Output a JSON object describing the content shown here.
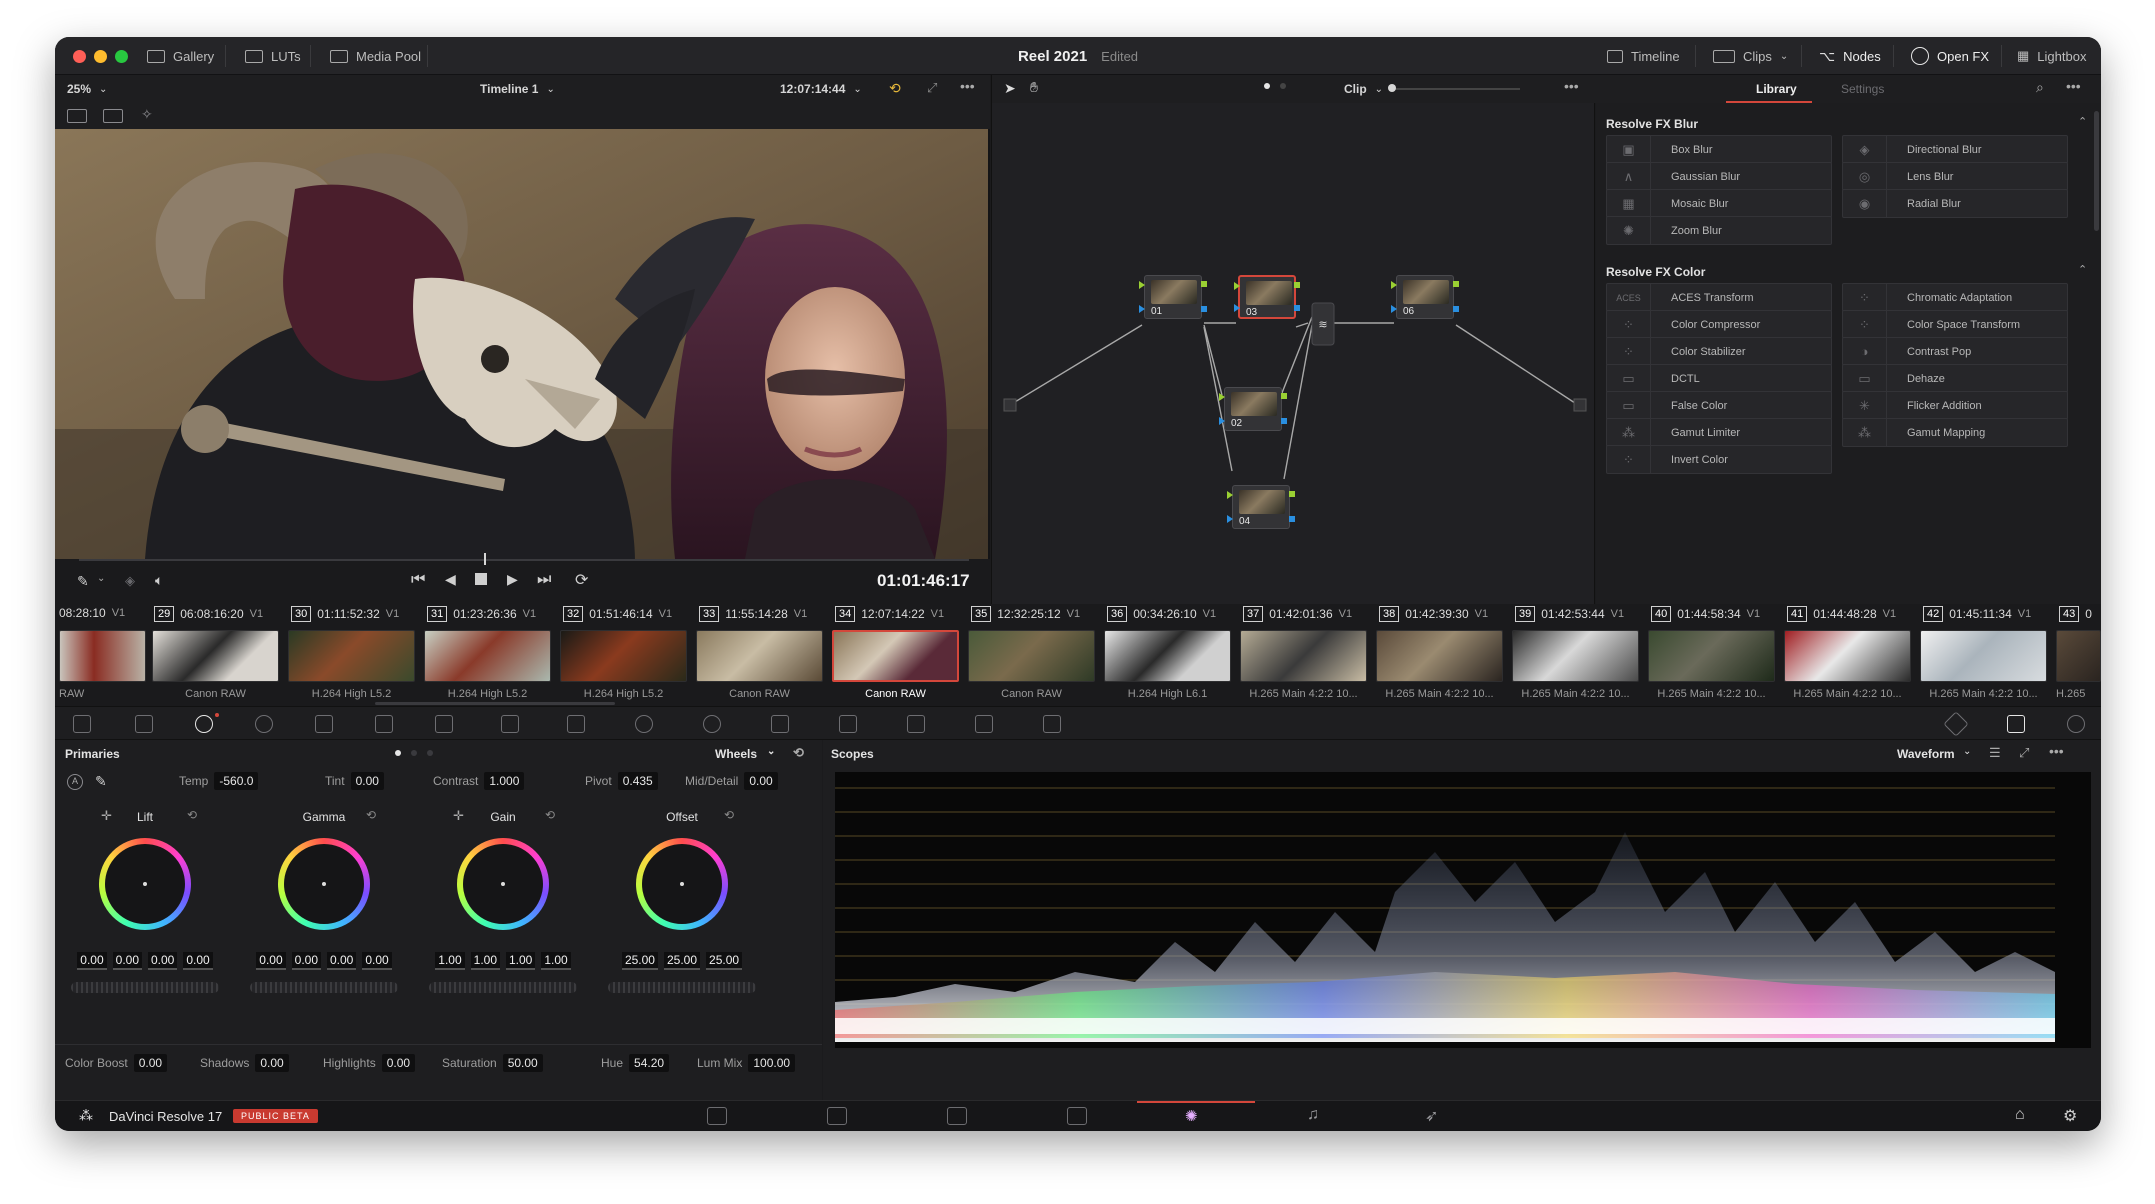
{
  "titlebar": {
    "left_tabs": [
      "Gallery",
      "LUTs",
      "Media Pool"
    ],
    "project": "Reel 2021",
    "status": "Edited",
    "right_tabs": [
      "Timeline",
      "Clips",
      "Nodes",
      "Open FX",
      "Lightbox"
    ]
  },
  "viewer": {
    "zoom": "25%",
    "timeline_name": "Timeline 1",
    "timecode_top": "12:07:14:44",
    "timecode": "01:01:46:17"
  },
  "node_editor": {
    "mode": "Clip",
    "nodes": [
      "01",
      "02",
      "03",
      "04",
      "06"
    ]
  },
  "library": {
    "tabs": [
      "Library",
      "Settings"
    ],
    "sections": [
      {
        "title": "Resolve FX Blur",
        "items": [
          "Box Blur",
          "Directional Blur",
          "Gaussian Blur",
          "Lens Blur",
          "Mosaic Blur",
          "Radial Blur",
          "Zoom Blur"
        ]
      },
      {
        "title": "Resolve FX Color",
        "items": [
          "ACES Transform",
          "Chromatic Adaptation",
          "Color Compressor",
          "Color Space Transform",
          "Color Stabilizer",
          "Contrast Pop",
          "DCTL",
          "Dehaze",
          "False Color",
          "Flicker Addition",
          "Gamut Limiter",
          "Gamut Mapping",
          "Invert Color"
        ]
      }
    ]
  },
  "clips": [
    {
      "num": "",
      "tc": "08:28:10",
      "track": "V1",
      "codec": "RAW"
    },
    {
      "num": "29",
      "tc": "06:08:16:20",
      "track": "V1",
      "codec": "Canon RAW"
    },
    {
      "num": "30",
      "tc": "01:11:52:32",
      "track": "V1",
      "codec": "H.264 High L5.2"
    },
    {
      "num": "31",
      "tc": "01:23:26:36",
      "track": "V1",
      "codec": "H.264 High L5.2"
    },
    {
      "num": "32",
      "tc": "01:51:46:14",
      "track": "V1",
      "codec": "H.264 High L5.2"
    },
    {
      "num": "33",
      "tc": "11:55:14:28",
      "track": "V1",
      "codec": "Canon RAW"
    },
    {
      "num": "34",
      "tc": "12:07:14:22",
      "track": "V1",
      "codec": "Canon RAW"
    },
    {
      "num": "35",
      "tc": "12:32:25:12",
      "track": "V1",
      "codec": "Canon RAW"
    },
    {
      "num": "36",
      "tc": "00:34:26:10",
      "track": "V1",
      "codec": "H.264 High L6.1"
    },
    {
      "num": "37",
      "tc": "01:42:01:36",
      "track": "V1",
      "codec": "H.265 Main 4:2:2 10..."
    },
    {
      "num": "38",
      "tc": "01:42:39:30",
      "track": "V1",
      "codec": "H.265 Main 4:2:2 10..."
    },
    {
      "num": "39",
      "tc": "01:42:53:44",
      "track": "V1",
      "codec": "H.265 Main 4:2:2 10..."
    },
    {
      "num": "40",
      "tc": "01:44:58:34",
      "track": "V1",
      "codec": "H.265 Main 4:2:2 10..."
    },
    {
      "num": "41",
      "tc": "01:44:48:28",
      "track": "V1",
      "codec": "H.265 Main 4:2:2 10..."
    },
    {
      "num": "42",
      "tc": "01:45:11:34",
      "track": "V1",
      "codec": "H.265 Main 4:2:2 10..."
    },
    {
      "num": "43",
      "tc": "0",
      "track": "",
      "codec": "H.265"
    }
  ],
  "primaries": {
    "title": "Primaries",
    "mode": "Wheels",
    "top_params": [
      {
        "label": "Temp",
        "value": "-560.0"
      },
      {
        "label": "Tint",
        "value": "0.00"
      },
      {
        "label": "Contrast",
        "value": "1.000"
      },
      {
        "label": "Pivot",
        "value": "0.435"
      },
      {
        "label": "Mid/Detail",
        "value": "0.00"
      }
    ],
    "wheels": [
      {
        "name": "Lift",
        "values": [
          "0.00",
          "0.00",
          "0.00",
          "0.00"
        ]
      },
      {
        "name": "Gamma",
        "values": [
          "0.00",
          "0.00",
          "0.00",
          "0.00"
        ]
      },
      {
        "name": "Gain",
        "values": [
          "1.00",
          "1.00",
          "1.00",
          "1.00"
        ]
      },
      {
        "name": "Offset",
        "values": [
          "25.00",
          "25.00",
          "25.00"
        ]
      }
    ],
    "bottom_params": [
      {
        "label": "Color Boost",
        "value": "0.00"
      },
      {
        "label": "Shadows",
        "value": "0.00"
      },
      {
        "label": "Highlights",
        "value": "0.00"
      },
      {
        "label": "Saturation",
        "value": "50.00"
      },
      {
        "label": "Hue",
        "value": "54.20"
      },
      {
        "label": "Lum Mix",
        "value": "100.00"
      }
    ]
  },
  "scopes": {
    "title": "Scopes",
    "mode": "Waveform"
  },
  "status": {
    "app": "DaVinci Resolve 17",
    "badge": "PUBLIC BETA"
  },
  "colors": {
    "accent": "#d4473b",
    "node_green": "#9ad033",
    "node_blue": "#2a8fe0"
  }
}
